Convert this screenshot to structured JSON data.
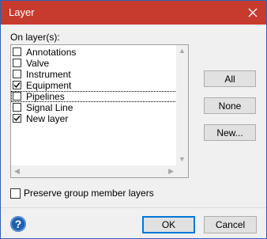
{
  "window": {
    "title": "Layer"
  },
  "section": {
    "label": "On layer(s):"
  },
  "layers": [
    {
      "label": "Annotations",
      "checked": false,
      "focused": false
    },
    {
      "label": "Valve",
      "checked": false,
      "focused": false
    },
    {
      "label": "Instrument",
      "checked": false,
      "focused": false
    },
    {
      "label": "Equipment",
      "checked": true,
      "focused": false
    },
    {
      "label": "Pipelines",
      "checked": false,
      "focused": true
    },
    {
      "label": "Signal Line",
      "checked": false,
      "focused": false
    },
    {
      "label": "New layer",
      "checked": true,
      "focused": false
    }
  ],
  "side_buttons": {
    "all": "All",
    "none": "None",
    "new": "New..."
  },
  "preserve": {
    "label": "Preserve group member layers",
    "checked": false
  },
  "footer": {
    "ok": "OK",
    "cancel": "Cancel"
  },
  "icons": {
    "close": "close-icon",
    "help": "help-icon",
    "check": "checkmark-icon"
  },
  "colors": {
    "titlebar": "#c73a2e",
    "accent": "#0078d7",
    "help": "#1f5fad"
  }
}
